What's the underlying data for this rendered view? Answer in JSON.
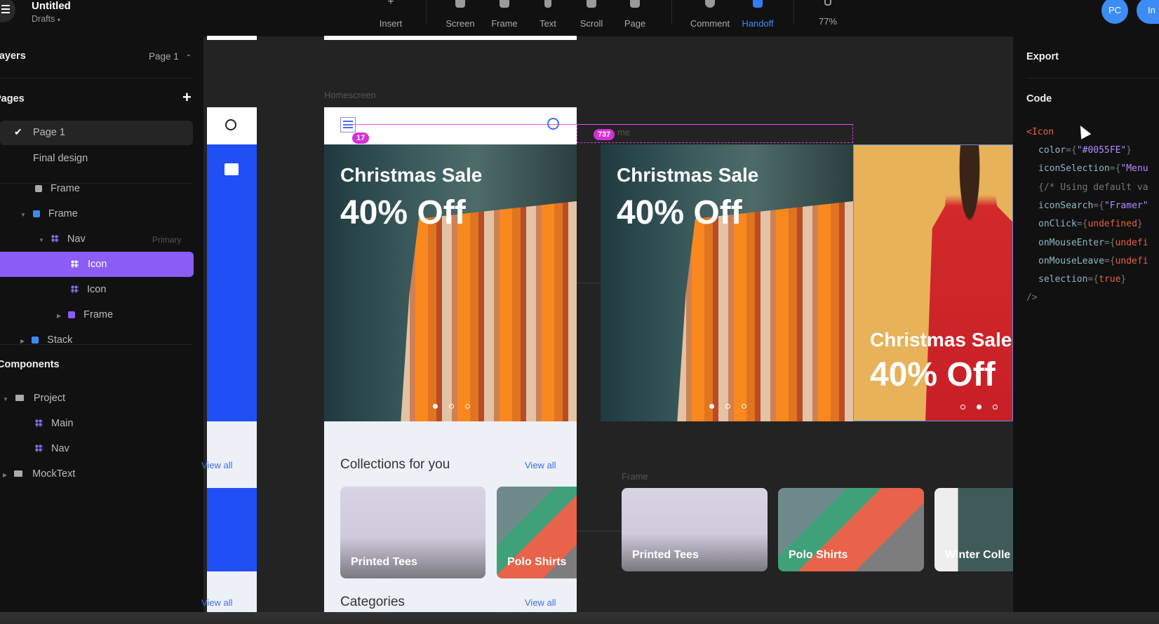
{
  "topbar": {
    "title": "Untitled",
    "project": "Drafts",
    "tools": [
      "Insert",
      "Screen",
      "Frame",
      "Text",
      "Scroll",
      "Page",
      "Comment",
      "Handoff",
      "77%"
    ],
    "active_tool": "Handoff",
    "avatars": [
      "PC",
      "In"
    ],
    "accent": "#2f7cf6"
  },
  "left": {
    "layers_label": "Layers",
    "page_selector": "Page 1",
    "pages_label": "Pages",
    "pages": [
      "Page 1",
      "Final design"
    ],
    "tree": [
      {
        "label": "Frame"
      },
      {
        "label": "Frame"
      },
      {
        "label": "Nav",
        "tag": "Primary"
      },
      {
        "label": "Icon",
        "selected": true
      },
      {
        "label": "Icon"
      },
      {
        "label": "Frame"
      },
      {
        "label": "Stack"
      }
    ],
    "components_label": "Components",
    "components": [
      "Project",
      "Main",
      "Nav",
      "MockText"
    ],
    "selection_color": "#8b5cf6"
  },
  "canvas": {
    "frame_label": "Homescreen",
    "frame2_label": "Frame",
    "hero_title": "Christmas Sale",
    "hero_discount": "40% Off",
    "collections_title": "Collections for you",
    "view_all": "View all",
    "categories_title": "Categories",
    "cards": [
      "Printed Tees",
      "Polo Shirts",
      "Winter Colle"
    ],
    "measure_badges": [
      "17",
      "737"
    ],
    "ghost_label": "me"
  },
  "right": {
    "export_label": "Export",
    "code_label": "Code",
    "code": {
      "open": "<Icon",
      "lines": [
        {
          "prop": "color",
          "value": "\"#0055FE\""
        },
        {
          "prop": "iconSelection",
          "value": "\"Menu"
        },
        {
          "comment": "{/* Using default va"
        },
        {
          "prop": "iconSearch",
          "value": "\"Framer\""
        },
        {
          "prop": "onClick",
          "value": "undefined"
        },
        {
          "prop": "onMouseEnter",
          "value": "undefi"
        },
        {
          "prop": "onMouseLeave",
          "value": "undefi"
        },
        {
          "prop": "selection",
          "value": "true"
        }
      ],
      "close": "/>"
    }
  }
}
